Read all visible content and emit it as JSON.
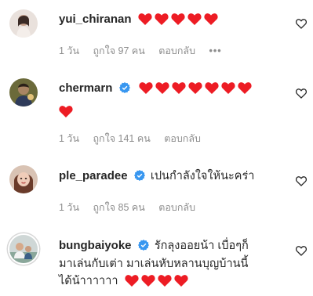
{
  "comments": [
    {
      "username": "yui_chiranan",
      "verified": false,
      "text": "",
      "hearts": 5,
      "meta": {
        "time": "1 วัน",
        "likes": "ถูกใจ 97 คน",
        "reply": "ตอบกลับ",
        "more": "•••"
      }
    },
    {
      "username": "chermarn",
      "verified": true,
      "text": "",
      "hearts": 8,
      "meta": {
        "time": "1 วัน",
        "likes": "ถูกใจ 141 คน",
        "reply": "ตอบกลับ"
      }
    },
    {
      "username": "ple_paradee",
      "verified": true,
      "text": "เปนกำลังใจให้นะคร่า",
      "hearts": 0,
      "meta": {
        "time": "1 วัน",
        "likes": "ถูกใจ 85 คน",
        "reply": "ตอบกลับ"
      }
    },
    {
      "username": "bungbaiyoke",
      "verified": true,
      "text": "รักลุงออยน้า เบื่อๆก็",
      "text_line2": "มาเล่นกับเต่า มาเล่นหับหลานบุญบ้านนี้",
      "text_line3": "ได้น้าาาาาา",
      "hearts": 4
    }
  ],
  "colors": {
    "heart": "#ed1c24",
    "verified": "#3897f0",
    "meta": "#8e8e8e",
    "text": "#262626"
  }
}
